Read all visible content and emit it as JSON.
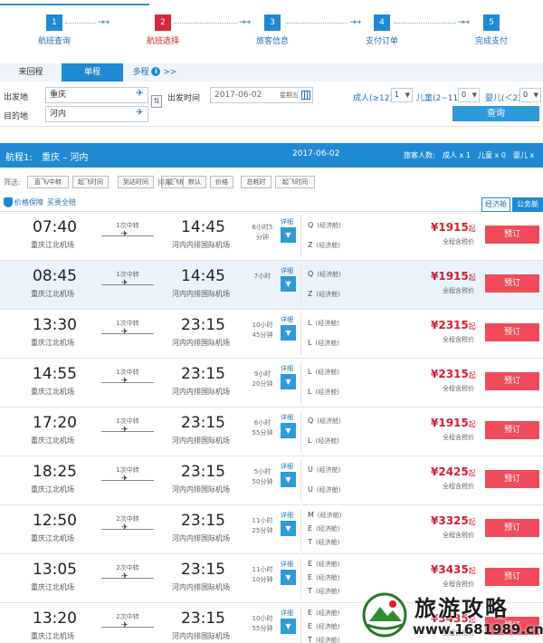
{
  "steps": [
    {
      "num": "1",
      "label": "航班查询"
    },
    {
      "num": "2",
      "label": "航班选择"
    },
    {
      "num": "3",
      "label": "旅客信息"
    },
    {
      "num": "4",
      "label": "支付订单"
    },
    {
      "num": "5",
      "label": "完成支付"
    }
  ],
  "step_arrow": "→→",
  "tabs": {
    "round_trip": "来回程",
    "one_way": "单程",
    "multi": "多程",
    "multi_suffix": ">>",
    "info_glyph": "i"
  },
  "search": {
    "from_label": "出发地",
    "from_value": "重庆",
    "to_label": "目的地",
    "to_value": "河内",
    "depart_label": "出发时间",
    "depart_value": "2017-06-02",
    "weekday": "星期五",
    "adult_label": "成人(≥12)",
    "adult_value": "1",
    "child_label": "儿童(2~11)",
    "child_value": "0",
    "infant_label": "婴儿(＜2)",
    "infant_value": "0",
    "query_button": "查询"
  },
  "flight_header": {
    "leg": "航程1:",
    "route": "重庆 – 河内",
    "date": "2017-06-02",
    "pax_label": "旅客人数:",
    "adult": "成人 x 1",
    "child": "儿童 x 0",
    "infant": "婴儿 x"
  },
  "filters": {
    "filter_label": "筛选:",
    "filter_buttons": [
      "直飞/中转",
      "起飞时间",
      "到达时间",
      "起飞机场"
    ],
    "sort_label": "排序:",
    "sort_buttons": [
      "默认",
      "价格",
      "总耗时",
      "起飞时间"
    ]
  },
  "guarantee": {
    "text": "价格保障",
    "link": "买贵全赔"
  },
  "cabin_tabs": {
    "economy": "经济舱",
    "business": "公务舱"
  },
  "row_labels": {
    "detail": "详细",
    "tax": "全程含税价",
    "book": "预订",
    "currency": "¥",
    "price_suffix": "起",
    "plane": "✈",
    "dropdown": "▼"
  },
  "flights": [
    {
      "dep": "07:40",
      "dep_airport": "重庆江北机场",
      "stops": "1次中转",
      "arr": "14:45",
      "arr_airport": "河内内排国际机场",
      "dur1": "6小时5",
      "dur2": "分钟",
      "cabins": [
        {
          "c": "Q",
          "n": "(经济舱)"
        },
        {
          "c": "Z",
          "n": "(经济舱)"
        }
      ],
      "price": "1915"
    },
    {
      "dep": "08:45",
      "dep_airport": "重庆江北机场",
      "stops": "1次中转",
      "arr": "14:45",
      "arr_airport": "河内内排国际机场",
      "dur1": "7小时",
      "dur2": "",
      "cabins": [
        {
          "c": "Q",
          "n": "(经济舱)"
        },
        {
          "c": "Z",
          "n": "(经济舱)"
        }
      ],
      "price": "1915"
    },
    {
      "dep": "13:30",
      "dep_airport": "重庆江北机场",
      "stops": "1次中转",
      "arr": "23:15",
      "arr_airport": "河内内排国际机场",
      "dur1": "10小时",
      "dur2": "45分钟",
      "cabins": [
        {
          "c": "L",
          "n": "(经济舱)"
        },
        {
          "c": "L",
          "n": "(经济舱)"
        }
      ],
      "price": "2315"
    },
    {
      "dep": "14:55",
      "dep_airport": "重庆江北机场",
      "stops": "1次中转",
      "arr": "23:15",
      "arr_airport": "河内内排国际机场",
      "dur1": "9小时",
      "dur2": "20分钟",
      "cabins": [
        {
          "c": "L",
          "n": "(经济舱)"
        },
        {
          "c": "L",
          "n": "(经济舱)"
        }
      ],
      "price": "2315"
    },
    {
      "dep": "17:20",
      "dep_airport": "重庆江北机场",
      "stops": "1次中转",
      "arr": "23:15",
      "arr_airport": "河内内排国际机场",
      "dur1": "6小时",
      "dur2": "55分钟",
      "cabins": [
        {
          "c": "Q",
          "n": "(经济舱)"
        },
        {
          "c": "L",
          "n": "(经济舱)"
        }
      ],
      "price": "1915"
    },
    {
      "dep": "18:25",
      "dep_airport": "重庆江北机场",
      "stops": "1次中转",
      "arr": "23:15",
      "arr_airport": "河内内排国际机场",
      "dur1": "5小时",
      "dur2": "50分钟",
      "cabins": [
        {
          "c": "U",
          "n": "(经济舱)"
        },
        {
          "c": "U",
          "n": "(经济舱)"
        }
      ],
      "price": "2425"
    },
    {
      "dep": "12:50",
      "dep_airport": "重庆江北机场",
      "stops": "2次中转",
      "arr": "23:15",
      "arr_airport": "河内内排国际机场",
      "dur1": "11小时",
      "dur2": "25分钟",
      "cabins": [
        {
          "c": "M",
          "n": "(经济舱)"
        },
        {
          "c": "E",
          "n": "(经济舱)"
        },
        {
          "c": "T",
          "n": "(经济舱)"
        }
      ],
      "price": "3325"
    },
    {
      "dep": "13:05",
      "dep_airport": "重庆江北机场",
      "stops": "2次中转",
      "arr": "23:15",
      "arr_airport": "河内内排国际机场",
      "dur1": "11小时",
      "dur2": "10分钟",
      "cabins": [
        {
          "c": "E",
          "n": "(经济舱)"
        },
        {
          "c": "E",
          "n": "(经济舱)"
        },
        {
          "c": "T",
          "n": "(经济舱)"
        }
      ],
      "price": "3435"
    },
    {
      "dep": "13:20",
      "dep_airport": "重庆江北机场",
      "stops": "2次中转",
      "arr": "23:15",
      "arr_airport": "河内内排国际机场",
      "dur1": "10小时",
      "dur2": "55分钟",
      "cabins": [
        {
          "c": "E",
          "n": "(经济舱)"
        },
        {
          "c": "E",
          "n": "(经济舱)"
        },
        {
          "c": "T",
          "n": "(经济舱)"
        }
      ],
      "price": "3435"
    }
  ],
  "watermark": {
    "title": "旅游攻略",
    "url": "www.1681989.cn"
  },
  "colors": {
    "primary": "#1f8ad3",
    "active_step": "#d6283a",
    "price": "#d0202f",
    "book_button": "#ef4b5b"
  }
}
